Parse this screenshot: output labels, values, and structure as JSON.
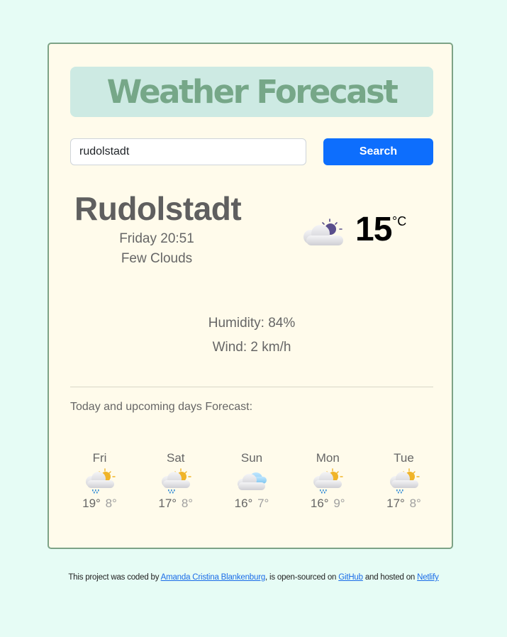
{
  "header": {
    "title": "Weather Forecast"
  },
  "search": {
    "value": "rudolstadt",
    "button_label": "Search"
  },
  "current": {
    "city": "Rudolstadt",
    "datetime": "Friday 20:51",
    "description": "Few Clouds",
    "icon": "few-clouds-night-icon",
    "temperature": "15",
    "unit": "°C",
    "humidity": "Humidity: 84%",
    "wind": "Wind: 2 km/h"
  },
  "forecast": {
    "title": "Today and upcoming days Forecast:",
    "days": [
      {
        "day": "Fri",
        "icon": "rain-sun-icon",
        "max": "19°",
        "min": "8°"
      },
      {
        "day": "Sat",
        "icon": "rain-sun-icon",
        "max": "17°",
        "min": "8°"
      },
      {
        "day": "Sun",
        "icon": "cloudy-icon",
        "max": "16°",
        "min": "7°"
      },
      {
        "day": "Mon",
        "icon": "rain-sun-icon",
        "max": "16°",
        "min": "9°"
      },
      {
        "day": "Tue",
        "icon": "rain-sun-icon",
        "max": "17°",
        "min": "8°"
      }
    ]
  },
  "footer": {
    "text1": "This project was coded by ",
    "author": "Amanda Cristina Blankenburg",
    "text2": ", is open-sourced on ",
    "github": "GitHub",
    "text3": " and hosted on ",
    "netlify": "Netlify"
  },
  "colors": {
    "page_bg": "#e6fcf5",
    "card_bg": "#fffbeb",
    "card_border": "#7da386",
    "title_bg": "#cdeae3",
    "title_text": "#76a788",
    "button": "#0d6efd",
    "link": "#1a6ce8"
  }
}
